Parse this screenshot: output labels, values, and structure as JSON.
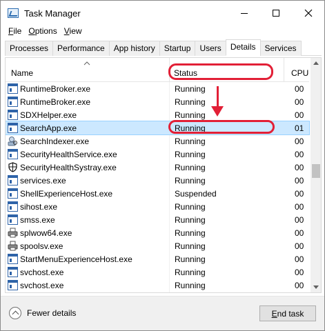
{
  "window": {
    "title": "Task Manager"
  },
  "menu": [
    {
      "underline": "F",
      "rest": "ile"
    },
    {
      "underline": "O",
      "rest": "ptions"
    },
    {
      "underline": "V",
      "rest": "iew"
    }
  ],
  "tabs": [
    "Processes",
    "Performance",
    "App history",
    "Startup",
    "Users",
    "Details",
    "Services"
  ],
  "active_tab": "Details",
  "table": {
    "columns": {
      "name": "Name",
      "status": "Status",
      "cpu": "CPU"
    },
    "rows": [
      {
        "name": "RuntimeBroker.exe",
        "status": "Running",
        "cpu": "00",
        "icon": "exe-icon"
      },
      {
        "name": "RuntimeBroker.exe",
        "status": "Running",
        "cpu": "00",
        "icon": "exe-icon"
      },
      {
        "name": "SDXHelper.exe",
        "status": "Running",
        "cpu": "00",
        "icon": "exe-icon"
      },
      {
        "name": "SearchApp.exe",
        "status": "Running",
        "cpu": "01",
        "icon": "exe-icon",
        "selected": true
      },
      {
        "name": "SearchIndexer.exe",
        "status": "Running",
        "cpu": "00",
        "icon": "search-person-icon"
      },
      {
        "name": "SecurityHealthService.exe",
        "status": "Running",
        "cpu": "00",
        "icon": "exe-icon"
      },
      {
        "name": "SecurityHealthSystray.exe",
        "status": "Running",
        "cpu": "00",
        "icon": "shield-icon"
      },
      {
        "name": "services.exe",
        "status": "Running",
        "cpu": "00",
        "icon": "exe-icon"
      },
      {
        "name": "ShellExperienceHost.exe",
        "status": "Suspended",
        "cpu": "00",
        "icon": "exe-icon"
      },
      {
        "name": "sihost.exe",
        "status": "Running",
        "cpu": "00",
        "icon": "exe-icon"
      },
      {
        "name": "smss.exe",
        "status": "Running",
        "cpu": "00",
        "icon": "exe-icon"
      },
      {
        "name": "splwow64.exe",
        "status": "Running",
        "cpu": "00",
        "icon": "printer-icon"
      },
      {
        "name": "spoolsv.exe",
        "status": "Running",
        "cpu": "00",
        "icon": "printer-icon"
      },
      {
        "name": "StartMenuExperienceHost.exe",
        "status": "Running",
        "cpu": "00",
        "icon": "exe-icon"
      },
      {
        "name": "svchost.exe",
        "status": "Running",
        "cpu": "00",
        "icon": "exe-icon"
      },
      {
        "name": "svchost.exe",
        "status": "Running",
        "cpu": "00",
        "icon": "exe-icon"
      }
    ]
  },
  "footer": {
    "fewer_details": "Fewer details",
    "end_task": {
      "underline": "E",
      "rest": "nd task"
    }
  },
  "colors": {
    "annotation": "#e21f36",
    "selection": "#cce8ff"
  }
}
